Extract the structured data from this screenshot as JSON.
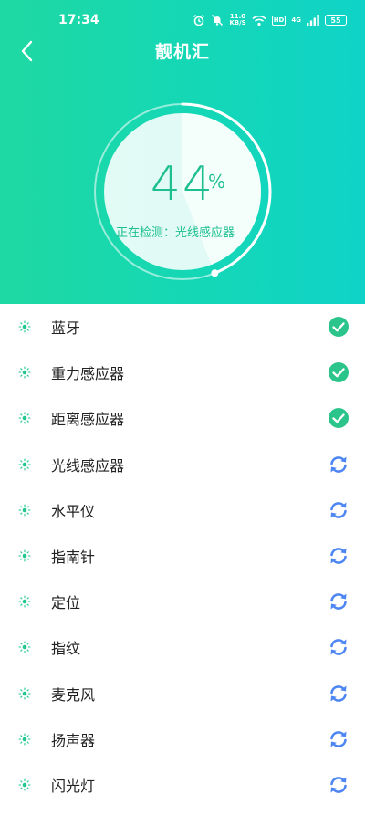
{
  "status_bar": {
    "time": "17:34",
    "net_speed_value": "11.0",
    "net_speed_unit": "KB/S",
    "hd_label": "HD",
    "signal_label": "4G",
    "battery": "55"
  },
  "header": {
    "title": "靓机汇",
    "back_icon": "chevron-left-icon"
  },
  "progress": {
    "percent": 44,
    "percent_text": "44",
    "percent_sign": "%",
    "detecting_text": "正在检测：光线感应器"
  },
  "sensors": [
    {
      "label": "蓝牙",
      "status": "done"
    },
    {
      "label": "重力感应器",
      "status": "done"
    },
    {
      "label": "距离感应器",
      "status": "done"
    },
    {
      "label": "光线感应器",
      "status": "pending"
    },
    {
      "label": "水平仪",
      "status": "pending"
    },
    {
      "label": "指南针",
      "status": "pending"
    },
    {
      "label": "定位",
      "status": "pending"
    },
    {
      "label": "指纹",
      "status": "pending"
    },
    {
      "label": "麦克风",
      "status": "pending"
    },
    {
      "label": "扬声器",
      "status": "pending"
    },
    {
      "label": "闪光灯",
      "status": "pending"
    }
  ],
  "colors": {
    "header_start": "#1fd9a2",
    "header_end": "#10d3c8",
    "done": "#2bc48a",
    "pending": "#4d86f2",
    "accent_text": "#1dbf90"
  }
}
